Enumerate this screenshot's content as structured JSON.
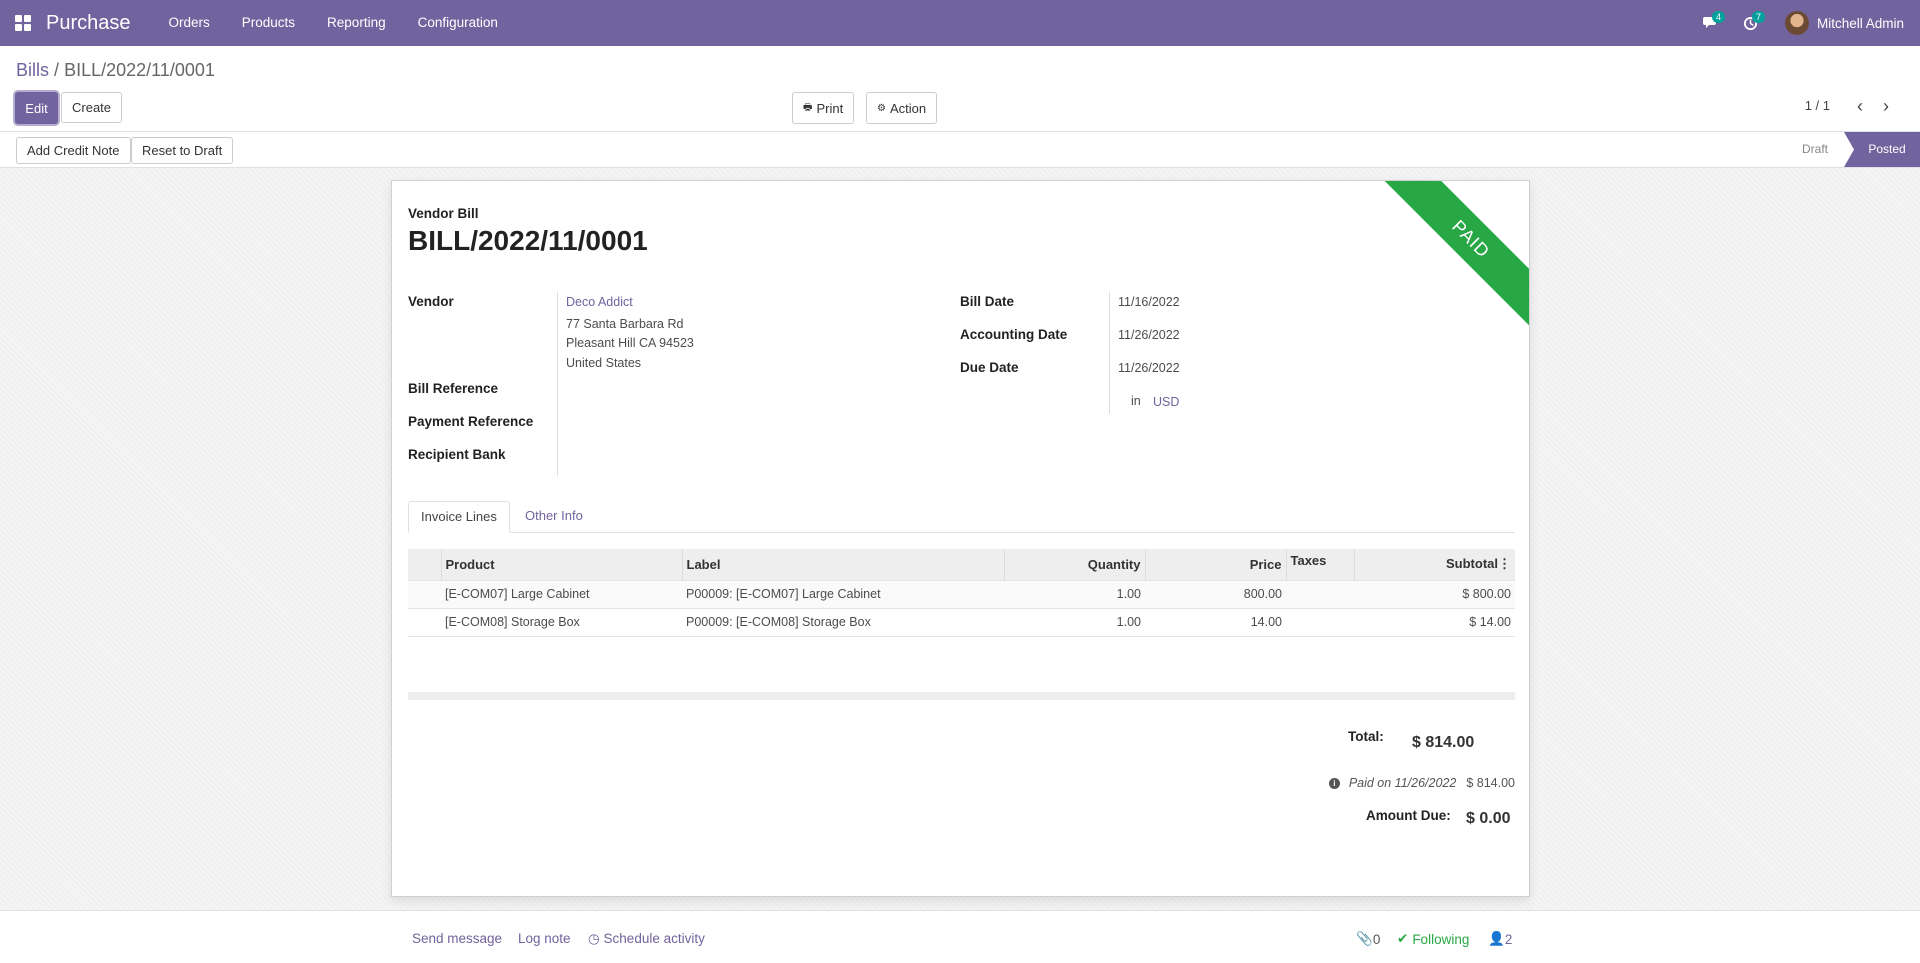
{
  "navbar": {
    "app_name": "Purchase",
    "menu": [
      "Orders",
      "Products",
      "Reporting",
      "Configuration"
    ],
    "messages_count": "4",
    "activities_count": "7",
    "user_name": "Mitchell Admin"
  },
  "control_panel": {
    "breadcrumb_parent": "Bills",
    "breadcrumb_sep": "/",
    "breadcrumb_current": "BILL/2022/11/0001",
    "edit_label": "Edit",
    "create_label": "Create",
    "print_label": "Print",
    "action_label": "Action",
    "pager": "1 / 1"
  },
  "statusbar": {
    "add_credit_note": "Add Credit Note",
    "reset_to_draft": "Reset to Draft",
    "stages": [
      "Draft",
      "Posted"
    ],
    "current_stage": "Posted"
  },
  "sheet": {
    "ribbon": "PAID",
    "doc_type": "Vendor Bill",
    "doc_name": "BILL/2022/11/0001",
    "left_fields": {
      "vendor_label": "Vendor",
      "vendor_name": "Deco Addict",
      "vendor_address": [
        "77 Santa Barbara Rd",
        "Pleasant Hill CA 94523",
        "United States"
      ],
      "bill_reference_label": "Bill Reference",
      "payment_reference_label": "Payment Reference",
      "recipient_bank_label": "Recipient Bank"
    },
    "right_fields": {
      "bill_date_label": "Bill Date",
      "bill_date": "11/16/2022",
      "accounting_date_label": "Accounting Date",
      "accounting_date": "11/26/2022",
      "due_date_label": "Due Date",
      "due_date": "11/26/2022",
      "currency_in": "in",
      "currency": "USD"
    },
    "tabs": [
      "Invoice Lines",
      "Other Info"
    ],
    "table": {
      "headers": [
        "Product",
        "Label",
        "Quantity",
        "Price",
        "Taxes",
        "Subtotal"
      ],
      "rows": [
        [
          "[E-COM07] Large Cabinet",
          "P00009: [E-COM07] Large Cabinet",
          "1.00",
          "800.00",
          "",
          "$ 800.00"
        ],
        [
          "[E-COM08] Storage Box",
          "P00009: [E-COM08] Storage Box",
          "1.00",
          "14.00",
          "",
          "$ 14.00"
        ]
      ]
    },
    "totals": {
      "total_label": "Total:",
      "total_value": "$ 814.00",
      "paid_text": "Paid on 11/26/2022",
      "paid_amount": "$ 814.00",
      "amount_due_label": "Amount Due:",
      "amount_due_value": "$ 0.00"
    }
  },
  "chatter": {
    "send_message": "Send message",
    "log_note": "Log note",
    "schedule_activity": "Schedule activity",
    "attachments": "0",
    "following": "Following",
    "followers": "2"
  },
  "colors": {
    "brand": "#71639e",
    "paid_ribbon": "#28a745",
    "badge": "#00a09d"
  }
}
